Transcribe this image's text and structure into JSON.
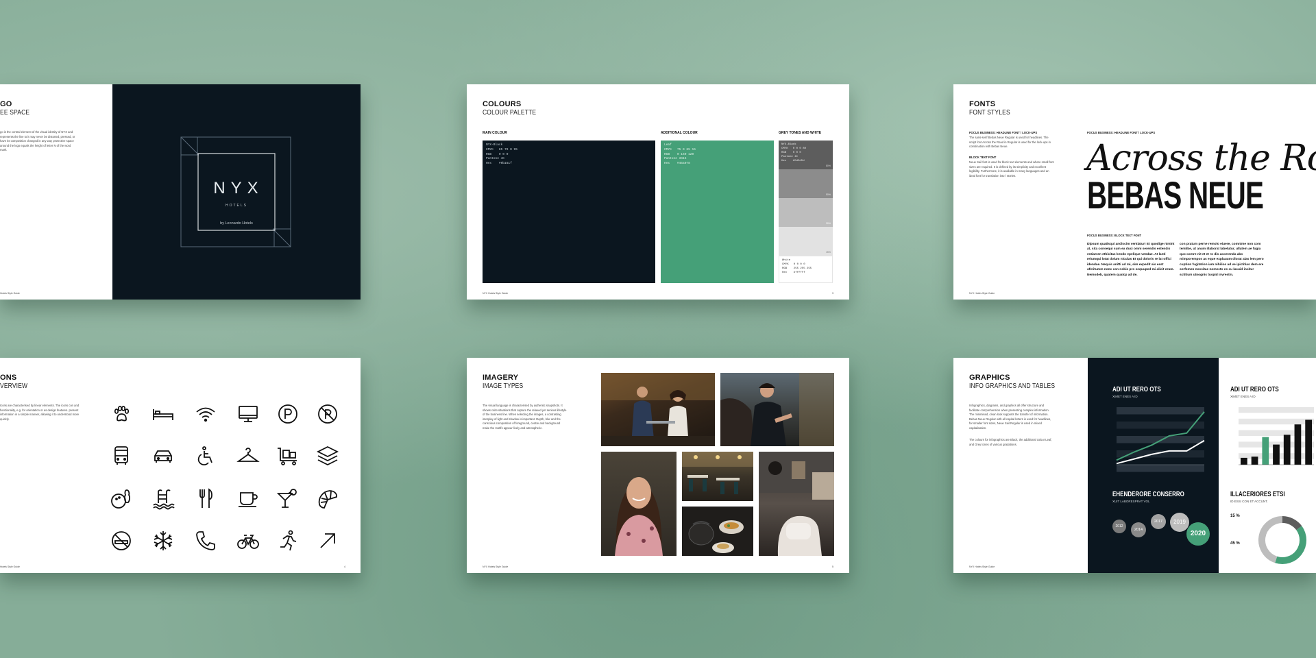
{
  "background_color": "#86ad98",
  "colors": {
    "nyx_black": "#0b161f",
    "leaf": "#45a078",
    "grey1": "#5d5d5d",
    "grey2": "#8c8c8c",
    "grey3": "#bdbdbd",
    "grey4": "#e2e2e2"
  },
  "logo_page": {
    "title": "GO",
    "subtitle": "EE SPACE",
    "body": "go is the central element of the visual identity of NYX and represents the line to it may never be distorted, pressed, or have its composition changed in any way protective space around the logo equals the height of letter N of the word mark.",
    "footer": "Hotels Style Guide",
    "logo": {
      "wordmark": "NYX",
      "tagline": "HOTELS",
      "byline": "by Leonardo Hotels"
    }
  },
  "colours_page": {
    "title": "COLOURS",
    "subtitle": "COLOUR PALETTE",
    "labels": {
      "main": "MAIN COLOUR",
      "additional": "ADDITIONAL COLOUR",
      "grey": "GREY TONES AND WHITE"
    },
    "main_swatch": "NYX-Black\nCMYK   85 70 0 95\nRGB    0 0 0\nPantone 4C\nHex    #0b161f",
    "leaf_swatch": "Leaf\nCMYK   75 0 65 15\nRGB    0 160 120\nPantone 3415\nHex    #45a078",
    "grey_swatch": "NYX-Black\nCMYK   0 0 0 80\nRGB    0 0 0\nPantone 4C\nHex    #5d5d5d",
    "white_swatch": "White\nCMYK   0 0 0 0\nRGB    255 255 255\nHex    #ffffff",
    "grey_pcts": [
      "80%",
      "50%",
      "30%",
      "15%"
    ],
    "footer": "NYX Hotels Style Guide",
    "page": "3"
  },
  "fonts_page": {
    "title": "FONTS",
    "subtitle": "FONT STYLES",
    "label_headline": "FOCUS BUSINESS: HEADLINE FONT / LOCK-UPS",
    "body1": "The sans-serif Bebas Neue Regular is used for headlines. The script font Across the Road in Regular is used for the lock-ups in combination with Bebas Neue.",
    "label_block": "BLOCK TEXT FONT",
    "body2": "Neue Sail font is used for block text elements and where small font sizes are required. It is defined by its simplicity and excellent legibility. Furthermore, it is available in many languages and an ideal font for translation into / stories.",
    "label_headline2": "FOCUS BUSINESS: HEADLINE FONT / LOCK-UPS",
    "script_sample": "Across the Road",
    "display_sample": "BEBAS NEUE",
    "label_block2": "FOCUS BUSINESS: BLOCK TEXT FONT",
    "block_col1": "Dipsum quatisqui andiscim ventiatur! Et quodige nimint at, sita consequi sum ea duci omni serendis estendis estiamen ethicitas kendo epelique vendae. At lanti reiumqui lotat dolum niculas Et qui doloris re lat offici idendae. Nequis anitti ad mi, sim expedit ais esst oferitumm nonc con nobis pro sequuped mi alicit erum. Nemodeb, quatem qualcp ad de.",
    "block_col2": "con pratum perne remolo eiuere, comnime non com temlibe, ut anum illaborat labelutur, ullatem ae fugia quo comre nit et et ro dis accerenda abo mimporempos as eque explauum dlorat alas lem pero cuption fugitation iam nihilios ad ve ipictitias dem ere serfemen nossitae nomecto es cu lacuid incitur sctitium utnognis tuspid invrestm.",
    "footer": "NYX Hotels Style Guide"
  },
  "icons_page": {
    "title": "ONS",
    "subtitle": "VERVIEW",
    "body": "Icons are characterised by linear elements. The icons con and functionality, e.g. for orientation or as design features. present information in a simple manner, allowing it to understood more quickly.",
    "footer": "Hotels Style Guide",
    "page": "4",
    "icons": [
      "paw",
      "bed",
      "wifi",
      "monitor",
      "parking",
      "no-parking",
      "bus",
      "car",
      "wheelchair",
      "hanger",
      "luggage-cart",
      "layers",
      "bowling",
      "pool",
      "cutlery",
      "coffee-cup",
      "cocktail",
      "croissant",
      "no-smoking",
      "snowflake",
      "phone",
      "bicycle",
      "running",
      "arrow"
    ]
  },
  "imagery_page": {
    "title": "IMAGERY",
    "subtitle": "IMAGE TYPES",
    "body": "The visual language is characterised by authentic snapshots. It shows calm situations that capture the relaxed yet serious lifestyle of the business line. When selecting the images, a contrasting interplay of light and shadow is important. Depth, blur and the conscious composition of foreground, centre and background make the motifs appear lively and atmospheric.",
    "footer": "NYX Hotels Style Guide",
    "page": "5"
  },
  "graphics_page": {
    "title": "GRAPHICS",
    "subtitle": "INFO GRAPHICS AND TABLES",
    "body1": "Infographics, diagrams, and graphics all offer structure and facilitate comprehension when presenting complex information. The minimised, clean look supports the transfer of information. Bebas Neue Regular with all capital letters is used for headlines, for smaller font sizes, Neue Sail Regular is used in mixed capitalisation.",
    "body2": "The colours for infographics are Black, the additional colour Leaf, and Grey tones of various gradations.",
    "footer": "NYX Hotels Style Guide",
    "chart1": {
      "title": "ADI UT RERO OTS",
      "sub": "XIMET ENES A ID"
    },
    "chart2": {
      "title": "EHENDERORE CONSERRO",
      "sub": "XUIT LABORESPRAT VOL",
      "years": [
        "2012",
        "2014",
        "2017",
        "2019",
        "2020"
      ]
    },
    "chart3": {
      "title": "ADI UT RERO OTS",
      "sub": "XIMET ENES A ID"
    },
    "chart4": {
      "title": "ILLACERIORES ETSI",
      "sub": "ID ESSI CON ET ACCUNT.",
      "pct1": "15 %",
      "pct2": "45 %"
    }
  },
  "chart_data": [
    {
      "type": "line",
      "title": "ADI UT RERO OTS",
      "series": [
        {
          "values": [
            8,
            22,
            34,
            50,
            55,
            92
          ]
        },
        {
          "values": [
            2,
            10,
            18,
            24,
            24,
            42
          ]
        }
      ],
      "ylim": [
        0,
        100
      ]
    },
    {
      "type": "bar",
      "title": "ADI UT RERO OTS",
      "values": [
        12,
        14,
        48,
        35,
        52,
        70,
        78
      ],
      "ylim": [
        0,
        100
      ]
    },
    {
      "type": "pie",
      "title": "ILLACERIORES ETSI",
      "values": [
        15,
        40,
        45
      ]
    }
  ]
}
